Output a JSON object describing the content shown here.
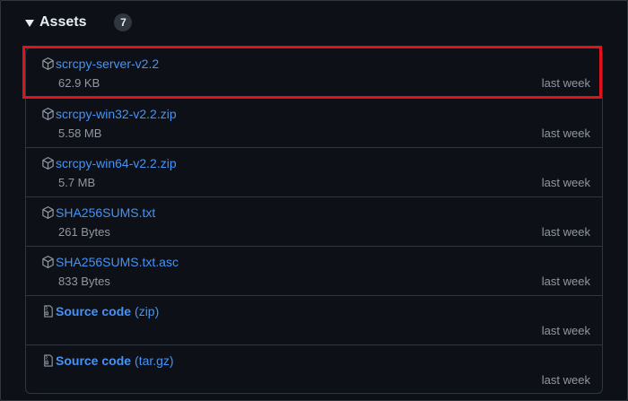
{
  "header": {
    "title": "Assets",
    "count": "7"
  },
  "assets": [
    {
      "name": "scrcpy-server-v2.2",
      "size": "62.9 KB",
      "time": "last week",
      "icon": "package-icon"
    },
    {
      "name": "scrcpy-win32-v2.2.zip",
      "size": "5.58 MB",
      "time": "last week",
      "icon": "package-icon"
    },
    {
      "name": "scrcpy-win64-v2.2.zip",
      "size": "5.7 MB",
      "time": "last week",
      "icon": "package-icon"
    },
    {
      "name": "SHA256SUMS.txt",
      "size": "261 Bytes",
      "time": "last week",
      "icon": "package-icon"
    },
    {
      "name": "SHA256SUMS.txt.asc",
      "size": "833 Bytes",
      "time": "last week",
      "icon": "package-icon"
    },
    {
      "name": "Source code",
      "format": "(zip)",
      "time": "last week",
      "icon": "file-zip-icon"
    },
    {
      "name": "Source code",
      "format": "(tar.gz)",
      "time": "last week",
      "icon": "file-zip-icon"
    }
  ],
  "highlight_color": "#e0121b",
  "link_color": "#4493f8"
}
